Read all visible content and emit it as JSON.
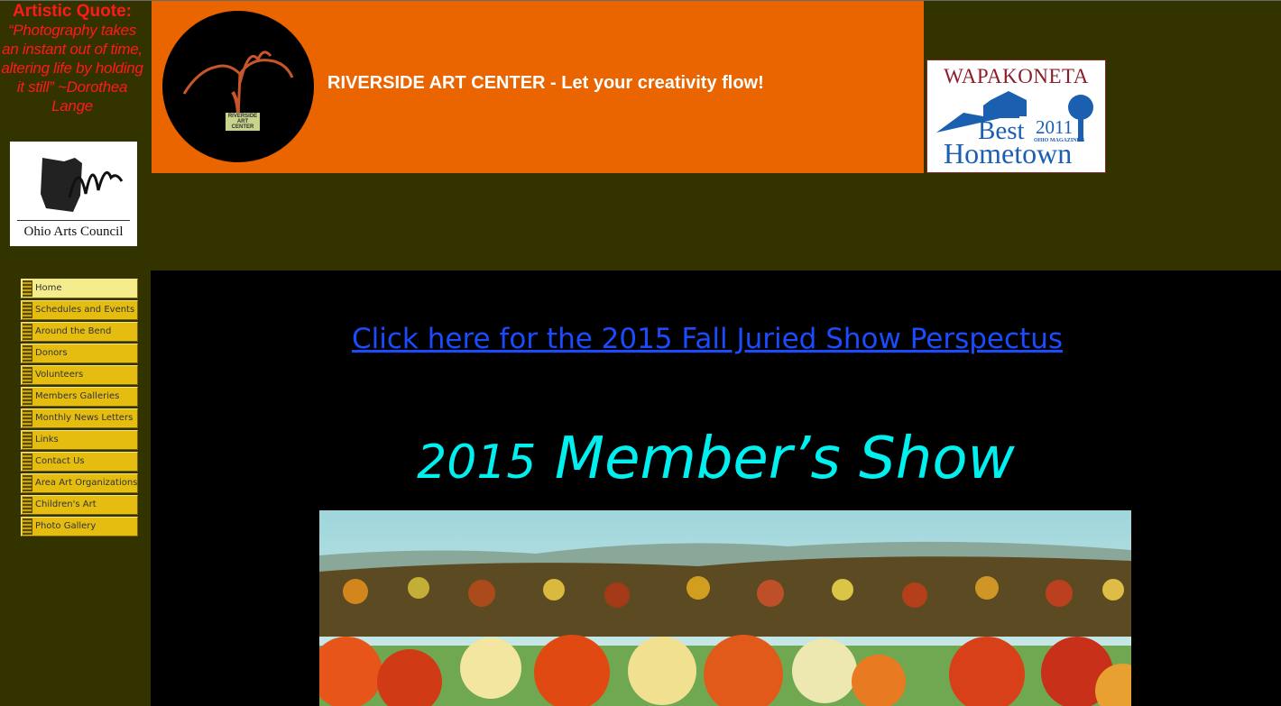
{
  "quote": {
    "title": "Artistic Quote:",
    "text": "“Photography takes an instant out of time, altering life by holding it still” ~Dorothea Lange"
  },
  "sponsor": {
    "label": "Ohio Arts Council"
  },
  "banner": {
    "logo_text": "RIVERSIDE ART CENTER",
    "tagline": "RIVERSIDE ART CENTER - Let your creativity flow!",
    "bg_color": "#ea6400"
  },
  "badge": {
    "top": "WAPAKONETA",
    "year": "2011",
    "best": "Best",
    "sub": "OHIO MAGAZINE'S",
    "hometown": "Hometown"
  },
  "nav": {
    "items": [
      {
        "label": "Home",
        "active": true
      },
      {
        "label": "Schedules and Events"
      },
      {
        "label": "Around the Bend"
      },
      {
        "label": "Donors"
      },
      {
        "label": "Volunteers"
      },
      {
        "label": "Members Galleries"
      },
      {
        "label": "Monthly News Letters"
      },
      {
        "label": "Links"
      },
      {
        "label": "Contact Us"
      },
      {
        "label": "Area Art Organizations"
      },
      {
        "label": "Children's Art"
      },
      {
        "label": "Photo Gallery"
      }
    ]
  },
  "main": {
    "link_text": "Click here for the 2015 Fall Juried Show Perspectus",
    "show_year": "2015",
    "show_name": "Member’s Show"
  },
  "colors": {
    "page_bg": "#333300",
    "nav_bg": "#e4bd10",
    "title_cyan": "#00f0f0",
    "link_blue": "#1a4bff",
    "quote_red": "#ff1a1a"
  }
}
